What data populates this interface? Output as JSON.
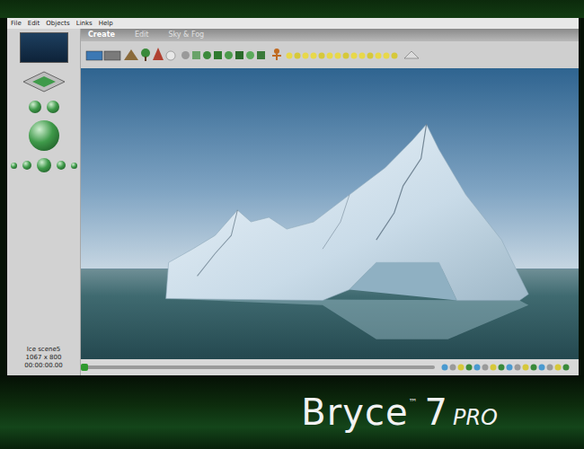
{
  "menu": [
    "File",
    "Edit",
    "Objects",
    "Links",
    "Help"
  ],
  "tabs": [
    {
      "label": "Create",
      "selected": true
    },
    {
      "label": "Edit",
      "selected": false
    },
    {
      "label": "Sky & Fog",
      "selected": false
    }
  ],
  "document": {
    "name": "Ice scene5",
    "size": "1067 x 800",
    "time": "00:00:00.00"
  },
  "timeline": {
    "level": 0.0
  },
  "brand": {
    "name": "Bryce",
    "mark": "™",
    "version": "7",
    "edition": "PRO"
  }
}
